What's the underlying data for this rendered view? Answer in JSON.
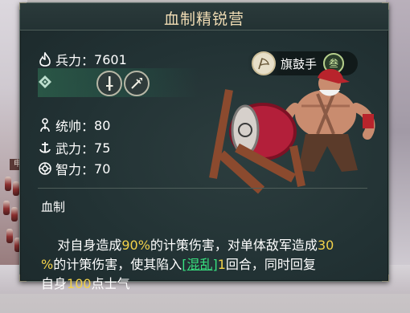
{
  "panel": {
    "title": "血制精锐营",
    "accent_color": "#f3d24a",
    "status_color": "#38e07f"
  },
  "stats": {
    "troops_label": "兵力",
    "troops_value": "7601",
    "command_label": "统帅",
    "command_value": "80",
    "force_label": "武力",
    "force_value": "75",
    "intellect_label": "智力",
    "intellect_value": "70",
    "separator": "："
  },
  "weapons": [
    {
      "icon": "sword-icon"
    },
    {
      "icon": "spear-icon"
    }
  ],
  "unit": {
    "name": "旗鼓手",
    "level": "叁",
    "icon": "flag-drum-icon"
  },
  "skill": {
    "name": "血制",
    "desc_parts": [
      {
        "text": "对自身造成",
        "type": "normal"
      },
      {
        "text": "90%",
        "type": "highlight"
      },
      {
        "text": "的计策伤害，对单体敌军造成",
        "type": "normal"
      },
      {
        "text": "30\n%",
        "type": "highlight"
      },
      {
        "text": "的计策伤害，使其陷入",
        "type": "normal"
      },
      {
        "text": "[混乱]",
        "type": "status"
      },
      {
        "text": "1",
        "type": "highlight"
      },
      {
        "text": "回合，同时回复\n自身",
        "type": "normal"
      },
      {
        "text": "100",
        "type": "highlight"
      },
      {
        "text": "点士气",
        "type": "normal"
      }
    ]
  },
  "background": {
    "unit_tag": "申"
  }
}
